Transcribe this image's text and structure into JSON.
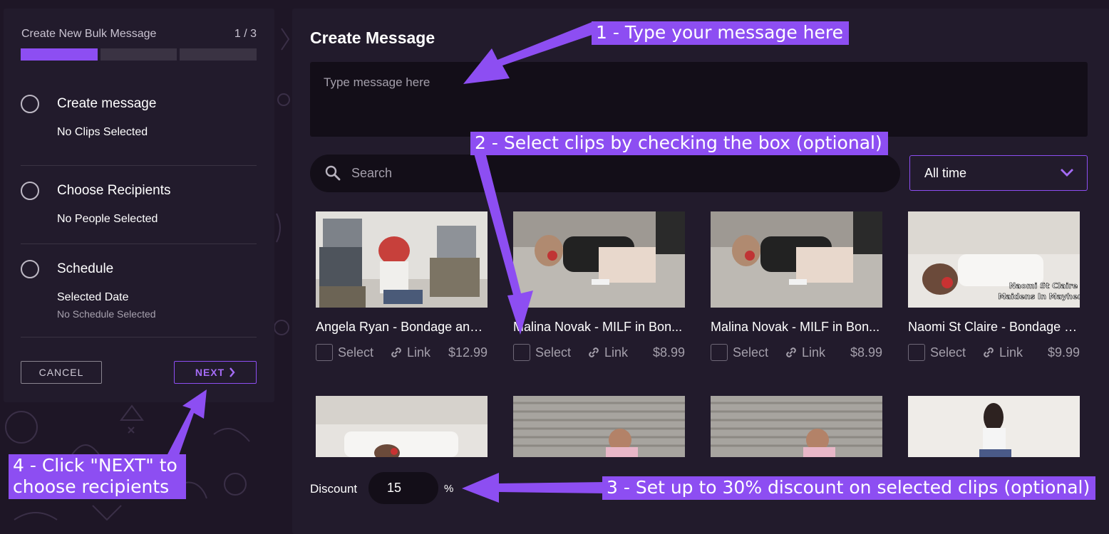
{
  "wizard": {
    "title": "Create New Bulk Message",
    "step_counter": "1 / 3",
    "steps": [
      {
        "title": "Create message",
        "subtitle": "No Clips Selected"
      },
      {
        "title": "Choose Recipients",
        "subtitle": "No People Selected"
      },
      {
        "title": "Schedule",
        "subtitle": "Selected Date",
        "detail": "No Schedule Selected"
      }
    ],
    "progress_segments": 3,
    "progress_active": 1,
    "cancel_label": "CANCEL",
    "next_label": "NEXT"
  },
  "main": {
    "title": "Create Message",
    "message_placeholder": "Type message here",
    "search_placeholder": "Search",
    "time_filter": "All time",
    "clips": [
      {
        "title": "Angela Ryan - Bondage and...",
        "select_label": "Select",
        "link_label": "Link",
        "price": "$12.99"
      },
      {
        "title": "Malina Novak - MILF in Bon...",
        "select_label": "Select",
        "link_label": "Link",
        "price": "$8.99"
      },
      {
        "title": "Malina Novak - MILF in Bon...",
        "select_label": "Select",
        "link_label": "Link",
        "price": "$8.99"
      },
      {
        "title": "Naomi St Claire - Bondage a...",
        "select_label": "Select",
        "link_label": "Link",
        "price": "$9.99",
        "thumb_caption_line1": "Naomi St Claire",
        "thumb_caption_line2": "Maidens In Mayhem"
      }
    ],
    "discount_label": "Discount",
    "discount_value": "15",
    "discount_unit": "%"
  },
  "annotations": {
    "step1": "1 - Type your message here",
    "step2": "2 - Select clips by checking the box (optional)",
    "step3": "3 - Set up to 30% discount on selected clips (optional)",
    "step4_line1": "4 - Click \"NEXT\" to",
    "step4_line2": "choose recipients"
  },
  "colors": {
    "accent": "#8d4ef2",
    "panel": "#221b2c",
    "input_bg": "#130e18",
    "page_bg": "#1e1626"
  }
}
